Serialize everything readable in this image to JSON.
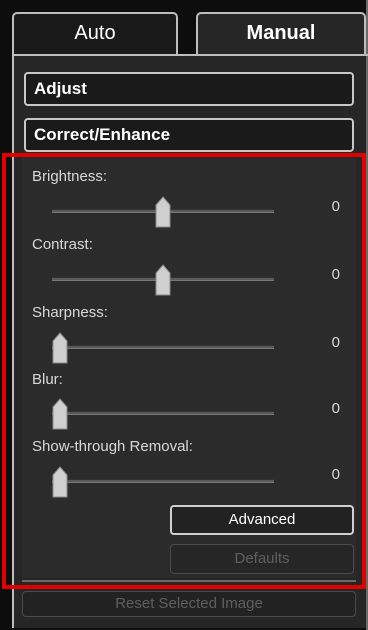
{
  "tabs": {
    "auto_label": "Auto",
    "manual_label": "Manual"
  },
  "sections": {
    "adjust_label": "Adjust",
    "correct_label": "Correct/Enhance"
  },
  "sliders": [
    {
      "label": "Brightness:",
      "value": "0",
      "level": 0.5
    },
    {
      "label": "Contrast:",
      "value": "0",
      "level": 0.5
    },
    {
      "label": "Sharpness:",
      "value": "0",
      "level": 0.0
    },
    {
      "label": "Blur:",
      "value": "0",
      "level": 0.0
    },
    {
      "label": "Show-through Removal:",
      "value": "0",
      "level": 0.0
    }
  ],
  "buttons": {
    "advanced_label": "Advanced",
    "defaults_label": "Defaults",
    "reset_label": "Reset Selected Image"
  },
  "colors": {
    "highlight": "#e00000",
    "panel_bg": "#262626"
  }
}
